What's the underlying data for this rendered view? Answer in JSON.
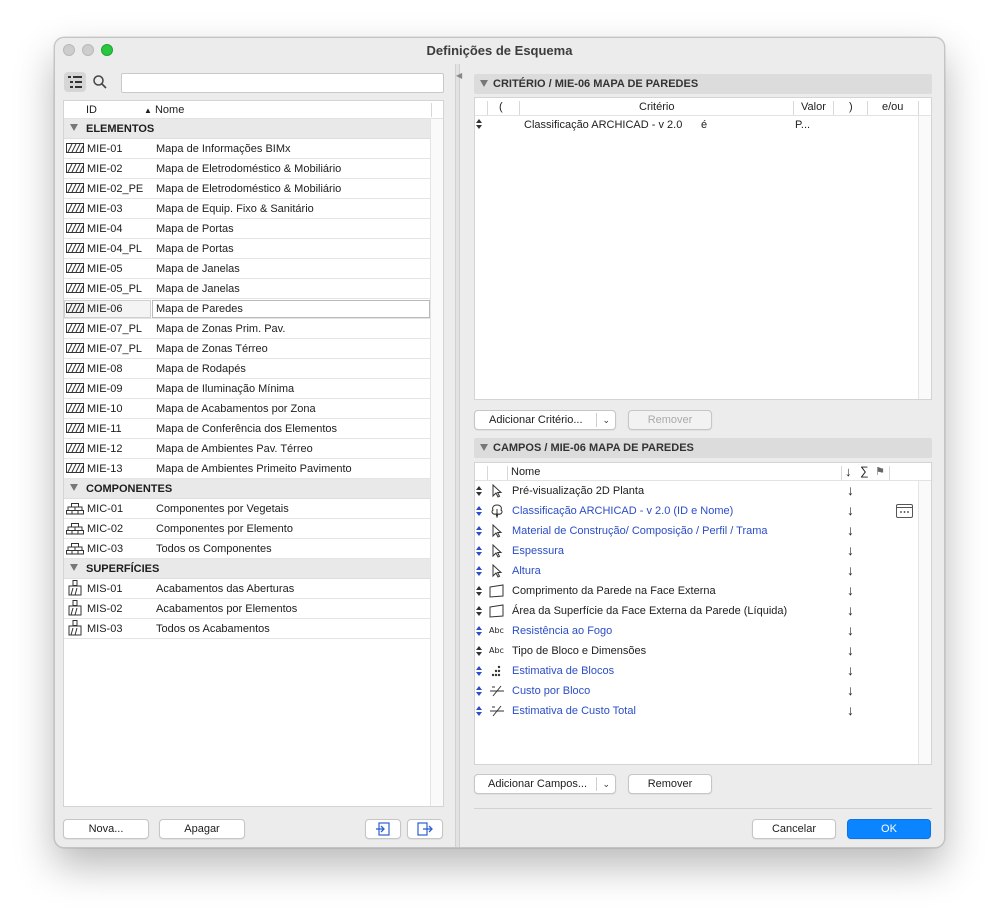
{
  "window": {
    "title": "Definições de Esquema"
  },
  "left": {
    "search_value": "",
    "columns": {
      "id": "ID",
      "name": "Nome"
    },
    "groups": [
      {
        "label": "ELEMENTOS",
        "icon": "wall-hatch-icon",
        "rows": [
          {
            "id": "MIE-01",
            "name": "Mapa de Informações BIMx"
          },
          {
            "id": "MIE-02",
            "name": "Mapa de Eletrodoméstico & Mobiliário"
          },
          {
            "id": "MIE-02_PE",
            "name": "Mapa de Eletrodoméstico & Mobiliário"
          },
          {
            "id": "MIE-03",
            "name": "Mapa de Equip. Fixo & Sanitário"
          },
          {
            "id": "MIE-04",
            "name": "Mapa de Portas"
          },
          {
            "id": "MIE-04_PL",
            "name": "Mapa de Portas"
          },
          {
            "id": "MIE-05",
            "name": "Mapa de Janelas"
          },
          {
            "id": "MIE-05_PL",
            "name": "Mapa de Janelas"
          },
          {
            "id": "MIE-06",
            "name": "Mapa de Paredes",
            "selected": true
          },
          {
            "id": "MIE-07_PL",
            "name": "Mapa de Zonas Prim. Pav."
          },
          {
            "id": "MIE-07_PL",
            "name": "Mapa de Zonas Térreo"
          },
          {
            "id": "MIE-08",
            "name": "Mapa de Rodapés"
          },
          {
            "id": "MIE-09",
            "name": "Mapa de Iluminação Mínima"
          },
          {
            "id": "MIE-10",
            "name": "Mapa de Acabamentos por Zona"
          },
          {
            "id": "MIE-11",
            "name": "Mapa de Conferência dos Elementos"
          },
          {
            "id": "MIE-12",
            "name": "Mapa de Ambientes Pav. Térreo"
          },
          {
            "id": "MIE-13",
            "name": "Mapa de Ambientes Primeito Pavimento"
          }
        ]
      },
      {
        "label": "COMPONENTES",
        "icon": "brick-stack-icon",
        "rows": [
          {
            "id": "MIC-01",
            "name": "Componentes por Vegetais"
          },
          {
            "id": "MIC-02",
            "name": "Componentes por Elemento"
          },
          {
            "id": "MIC-03",
            "name": "Todos os Componentes"
          }
        ]
      },
      {
        "label": "SUPERFÍCIES",
        "icon": "paint-brush-icon",
        "rows": [
          {
            "id": "MIS-01",
            "name": "Acabamentos das Aberturas"
          },
          {
            "id": "MIS-02",
            "name": "Acabamentos por Elementos"
          },
          {
            "id": "MIS-03",
            "name": "Todos os Acabamentos"
          }
        ]
      }
    ],
    "buttons": {
      "new": "Nova...",
      "delete": "Apagar"
    }
  },
  "criteria": {
    "header": "CRITÉRIO / MIE-06 MAPA DE PAREDES",
    "columns": {
      "open": "(",
      "criterion": "Critério",
      "value": "Valor",
      "close": ")",
      "andor": "e/ou"
    },
    "rows": [
      {
        "criterion": "Classificação ARCHICAD - v 2.0",
        "op": "é",
        "value": "P..."
      }
    ],
    "buttons": {
      "add": "Adicionar Critério...",
      "remove": "Remover"
    }
  },
  "fields": {
    "header": "CAMPOS / MIE-06 MAPA DE PAREDES",
    "columns": {
      "name": "Nome",
      "sort": "↓",
      "sum": "∑",
      "flag": "⚑"
    },
    "rows": [
      {
        "name": "Pré-visualização 2D Planta",
        "icon": "cursor-arrow-icon",
        "blue": false,
        "updown": "dark"
      },
      {
        "name": "Classificação ARCHICAD - v 2.0 (ID e Nome)",
        "icon": "classification-tree-icon",
        "blue": true,
        "updown": "blue",
        "extra": true
      },
      {
        "name": "Material de Construção/ Composição / Perfil / Trama",
        "icon": "cursor-arrow-icon",
        "blue": true,
        "updown": "blue"
      },
      {
        "name": "Espessura",
        "icon": "cursor-arrow-icon",
        "blue": true,
        "updown": "blue"
      },
      {
        "name": "Altura",
        "icon": "cursor-arrow-icon",
        "blue": true,
        "updown": "blue"
      },
      {
        "name": "Comprimento da Parede na Face Externa",
        "icon": "wall-face-icon",
        "blue": false,
        "updown": "dark"
      },
      {
        "name": "Área da Superfície da Face Externa da Parede (Líquida)",
        "icon": "wall-face-icon",
        "blue": false,
        "updown": "dark"
      },
      {
        "name": "Resistência ao Fogo",
        "icon": "abc-text-icon",
        "blue": true,
        "updown": "blue"
      },
      {
        "name": "Tipo de Bloco e Dimensões",
        "icon": "abc-text-icon",
        "blue": false,
        "updown": "dark"
      },
      {
        "name": "Estimativa de Blocos",
        "icon": "dots-count-icon",
        "blue": true,
        "updown": "blue"
      },
      {
        "name": "Custo por Bloco",
        "icon": "formula-icon",
        "blue": true,
        "updown": "blue"
      },
      {
        "name": "Estimativa de Custo Total",
        "icon": "formula-icon",
        "blue": true,
        "updown": "blue"
      }
    ],
    "icon_text": {
      "abc": "Abc"
    },
    "buttons": {
      "add": "Adicionar Campos...",
      "remove": "Remover"
    }
  },
  "footer": {
    "cancel": "Cancelar",
    "ok": "OK"
  },
  "colors": {
    "accent": "#0a84ff",
    "link_blue": "#2b4dc7"
  }
}
